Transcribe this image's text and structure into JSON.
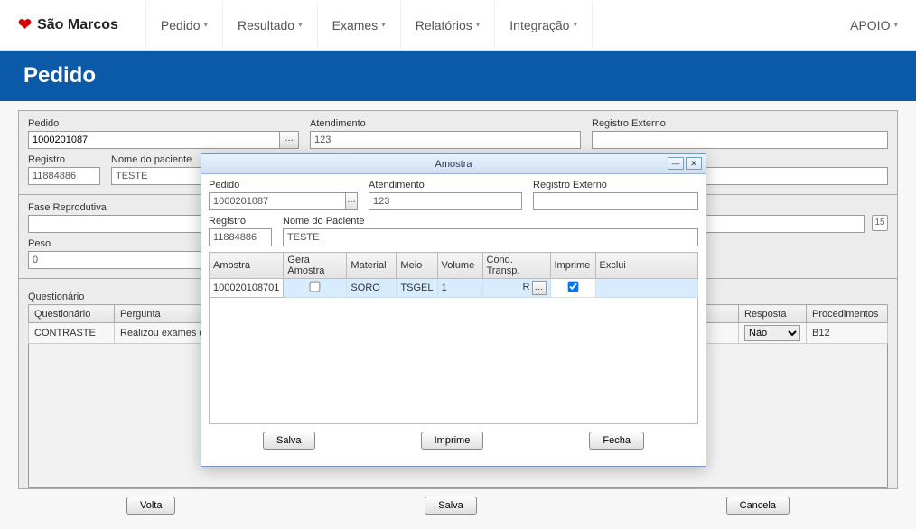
{
  "brand": "São Marcos",
  "nav": {
    "pedido": "Pedido",
    "resultado": "Resultado",
    "exames": "Exames",
    "relatorios": "Relatórios",
    "integracao": "Integração",
    "apoio": "APOIO"
  },
  "page_title": "Pedido",
  "form": {
    "pedido_label": "Pedido",
    "pedido_value": "1000201087",
    "atend_label": "Atendimento",
    "atend_value": "123",
    "regext_label": "Registro Externo",
    "regext_value": "",
    "registro_label": "Registro",
    "registro_value": "11884886",
    "nome_label": "Nome do paciente",
    "nome_value": "TESTE",
    "fase_label": "Fase Reprodutiva",
    "fase_value": "",
    "peso_label": "Peso",
    "peso_value": "0",
    "cal_text": "15"
  },
  "quest": {
    "label": "Questionário",
    "cols": {
      "q": "Questionário",
      "perg": "Pergunta",
      "resp": "Resposta",
      "proc": "Procedimentos"
    },
    "row": {
      "q": "CONTRASTE",
      "perg": "Realizou exames com contras",
      "resp": "Não",
      "proc": "B12"
    }
  },
  "buttons": {
    "volta": "Volta",
    "salva": "Salva",
    "cancela": "Cancela"
  },
  "modal": {
    "title": "Amostra",
    "pedido_label": "Pedido",
    "pedido_value": "1000201087",
    "atend_label": "Atendimento",
    "atend_value": "123",
    "regext_label": "Registro Externo",
    "regext_value": "",
    "registro_label": "Registro",
    "registro_value": "11884886",
    "nome_label": "Nome do Paciente",
    "nome_value": "TESTE",
    "cols": {
      "amostra": "Amostra",
      "gera": "Gera Amostra",
      "material": "Material",
      "meio": "Meio",
      "volume": "Volume",
      "cond": "Cond. Transp.",
      "imprime": "Imprime",
      "exclui": "Exclui"
    },
    "row": {
      "amostra": "100020108701",
      "gera": false,
      "material": "SORO",
      "meio": "TSGEL",
      "volume": "1",
      "cond": "R",
      "imprime": true
    },
    "actions": {
      "salva": "Salva",
      "imprime": "Imprime",
      "fecha": "Fecha"
    }
  }
}
